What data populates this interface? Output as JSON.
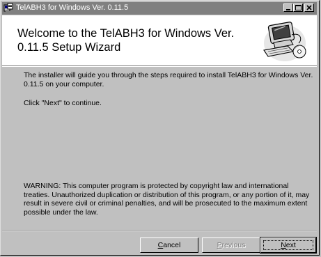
{
  "window": {
    "title": "TelABH3 for Windows Ver. 0.11.5"
  },
  "header": {
    "title": "Welcome to the TelABH3 for Windows Ver. 0.11.5 Setup Wizard"
  },
  "body": {
    "intro": "The installer will guide you through the steps required to install TelABH3 for Windows Ver. 0.11.5 on your computer.",
    "instruction": "Click \"Next\" to continue.",
    "warning": "WARNING: This computer program is protected by copyright law and international treaties. Unauthorized duplication or distribution of this program, or any portion of it, may result in severe civil or criminal penalties, and will be prosecuted to the maximum extent possible under the law."
  },
  "buttons": {
    "cancel": {
      "accel": "C",
      "rest": "ancel"
    },
    "previous": {
      "accel": "P",
      "rest": "revious"
    },
    "next": {
      "accel": "N",
      "rest": "ext"
    }
  },
  "colors": {
    "face": "#c0c0c0",
    "inactive_title": "#808080",
    "header_bg": "#ffffff"
  },
  "icons": [
    "setup-app-icon",
    "minimize-icon",
    "maximize-icon",
    "close-icon",
    "computer-wizard-icon"
  ]
}
